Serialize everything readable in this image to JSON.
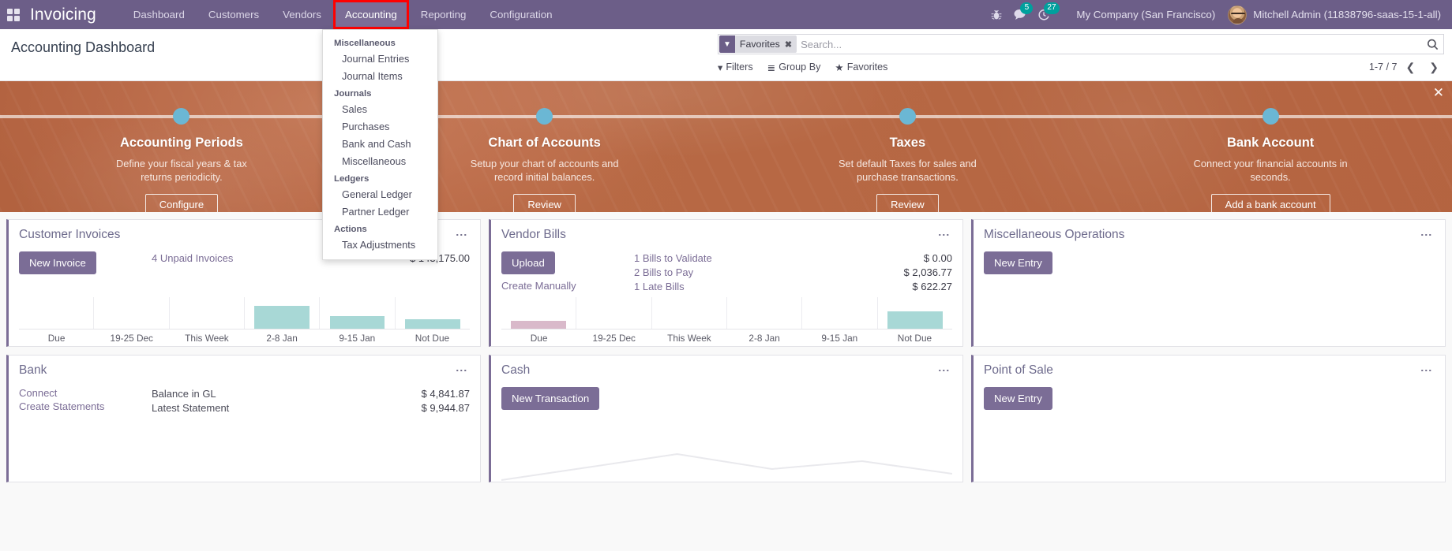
{
  "navbar": {
    "apps_icon": "apps-grid-icon",
    "brand": "Invoicing",
    "menu": [
      {
        "label": "Dashboard",
        "active": false
      },
      {
        "label": "Customers",
        "active": false
      },
      {
        "label": "Vendors",
        "active": false
      },
      {
        "label": "Accounting",
        "active": true
      },
      {
        "label": "Reporting",
        "active": false
      },
      {
        "label": "Configuration",
        "active": false
      }
    ],
    "bug_icon": "bug-icon",
    "messages_icon": "chat-bubble-icon",
    "messages_count": "5",
    "activities_icon": "clock-icon",
    "activities_count": "27",
    "company": "My Company (San Francisco)",
    "user": "Mitchell Admin (11838796-saas-15-1-all)"
  },
  "dropdown": {
    "sections": [
      {
        "title": "Miscellaneous",
        "items": [
          "Journal Entries",
          "Journal Items"
        ]
      },
      {
        "title": "Journals",
        "items": [
          "Sales",
          "Purchases",
          "Bank and Cash",
          "Miscellaneous"
        ]
      },
      {
        "title": "Ledgers",
        "items": [
          "General Ledger",
          "Partner Ledger"
        ]
      },
      {
        "title": "Actions",
        "items": [
          "Tax Adjustments"
        ]
      }
    ]
  },
  "control_panel": {
    "title": "Accounting Dashboard",
    "search": {
      "facet_icon": "filter-funnel-icon",
      "facet_label": "Favorites",
      "facet_remove_icon": "remove-facet-icon",
      "placeholder": "Search...",
      "value": "",
      "search_icon": "magnifier-icon"
    },
    "buttons": [
      {
        "icon": "funnel-icon",
        "label": "Filters"
      },
      {
        "icon": "hamburger-icon",
        "label": "Group By"
      },
      {
        "icon": "star-icon",
        "label": "Favorites"
      }
    ],
    "pager": {
      "range": "1-7 / 7",
      "prev_icon": "chevron-left-icon",
      "next_icon": "chevron-right-icon"
    }
  },
  "onboarding": {
    "close_icon": "close-icon",
    "steps": [
      {
        "title": "Accounting Periods",
        "desc": "Define your fiscal years & tax returns periodicity.",
        "button": "Configure"
      },
      {
        "title": "Chart of Accounts",
        "desc": "Setup your chart of accounts and record initial balances.",
        "button": "Review"
      },
      {
        "title": "Taxes",
        "desc": "Set default Taxes for sales and purchase transactions.",
        "button": "Review"
      },
      {
        "title": "Bank Account",
        "desc": "Connect your financial accounts in seconds.",
        "button": "Add a bank account"
      }
    ]
  },
  "cards": {
    "customer_invoices": {
      "title": "Customer Invoices",
      "kebab_icon": "kebab-menu-icon",
      "primary_button": "New Invoice",
      "stat_label": "4 Unpaid Invoices",
      "stat_value": "$ 143,175.00",
      "chart": {
        "categories": [
          "Due",
          "19-25 Dec",
          "This Week",
          "2-8 Jan",
          "9-15 Jan",
          "Not Due"
        ],
        "values": [
          0,
          0,
          0,
          100,
          52,
          40
        ]
      }
    },
    "vendor_bills": {
      "title": "Vendor Bills",
      "kebab_icon": "kebab-menu-icon",
      "primary_button": "Upload",
      "secondary_link": "Create Manually",
      "stats": [
        {
          "label": "1 Bills to Validate",
          "value": "$ 0.00"
        },
        {
          "label": "2 Bills to Pay",
          "value": "$ 2,036.77"
        },
        {
          "label": "1 Late Bills",
          "value": "$ 622.27"
        }
      ],
      "chart": {
        "categories": [
          "Due",
          "19-25 Dec",
          "This Week",
          "2-8 Jan",
          "9-15 Jan",
          "Not Due"
        ],
        "values": [
          40,
          0,
          0,
          0,
          0,
          72
        ]
      }
    },
    "miscellaneous_operations": {
      "title": "Miscellaneous Operations",
      "kebab_icon": "kebab-menu-icon",
      "primary_button": "New Entry"
    },
    "bank": {
      "title": "Bank",
      "kebab_icon": "kebab-menu-icon",
      "links": [
        "Connect",
        "Create Statements"
      ],
      "stats": [
        {
          "label": "Balance in GL",
          "value": "$ 4,841.87"
        },
        {
          "label": "Latest Statement",
          "value": "$ 9,944.87"
        }
      ]
    },
    "cash": {
      "title": "Cash",
      "kebab_icon": "kebab-menu-icon",
      "primary_button": "New Transaction"
    },
    "point_of_sale": {
      "title": "Point of Sale",
      "kebab_icon": "kebab-menu-icon",
      "primary_button": "New Entry"
    }
  },
  "colors": {
    "brand_purple": "#6c5e88",
    "card_accent": "#7b6d96",
    "banner_orange": "#b96c49",
    "step_dot": "#6bb7d4",
    "badge_teal": "#00a09d",
    "bar_teal": "#a8d8d6",
    "bar_pink": "#d9b9ca",
    "highlight_red": "#ff0000"
  }
}
